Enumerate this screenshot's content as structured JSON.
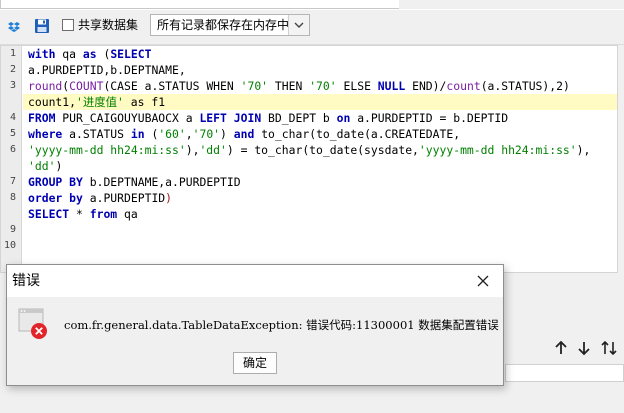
{
  "toolbar": {
    "share_label": "共享数据集",
    "memory_mode": "所有记录都保存在内存中"
  },
  "editor": {
    "line_numbers": [
      "1",
      "2",
      "3",
      "4",
      "5",
      "6",
      "7",
      "8",
      "9",
      "10"
    ],
    "lines": [
      [
        {
          "t": "with",
          "c": "kw"
        },
        {
          "t": " qa ",
          "c": ""
        },
        {
          "t": "as",
          "c": "kw"
        },
        {
          "t": " (",
          "c": ""
        },
        {
          "t": "SELECT",
          "c": "kw"
        }
      ],
      [
        {
          "t": "a.PURDEPTID,b.DEPTNAME,",
          "c": ""
        }
      ],
      [
        {
          "t": "round",
          "c": "fn"
        },
        {
          "t": "(",
          "c": ""
        },
        {
          "t": "COUNT",
          "c": "fn"
        },
        {
          "t": "(CASE a.STATUS WHEN ",
          "c": ""
        },
        {
          "t": "'70'",
          "c": "str"
        },
        {
          "t": " THEN ",
          "c": ""
        },
        {
          "t": "'70'",
          "c": "str"
        },
        {
          "t": " ELSE ",
          "c": ""
        },
        {
          "t": "NULL",
          "c": "kw"
        },
        {
          "t": " END)/",
          "c": ""
        },
        {
          "t": "count",
          "c": "fn"
        },
        {
          "t": "(a.STATUS),2)",
          "c": ""
        }
      ],
      [
        {
          "t": "count1,",
          "c": ""
        },
        {
          "t": "'进度值'",
          "c": "str"
        },
        {
          "t": " as f1",
          "c": ""
        }
      ],
      [
        {
          "t": "FROM",
          "c": "kw"
        },
        {
          "t": " PUR_CAIGOUYUBAOCX a ",
          "c": ""
        },
        {
          "t": "LEFT JOIN",
          "c": "kw"
        },
        {
          "t": " BD_DEPT b ",
          "c": ""
        },
        {
          "t": "on",
          "c": "kw"
        },
        {
          "t": " a.PURDEPTID = b.DEPTID",
          "c": ""
        }
      ],
      [
        {
          "t": "where",
          "c": "kw"
        },
        {
          "t": " a.STATUS ",
          "c": ""
        },
        {
          "t": "in",
          "c": "kw"
        },
        {
          "t": " (",
          "c": ""
        },
        {
          "t": "'60'",
          "c": "str"
        },
        {
          "t": ",",
          "c": ""
        },
        {
          "t": "'70'",
          "c": "str"
        },
        {
          "t": ") ",
          "c": ""
        },
        {
          "t": "and",
          "c": "kw"
        },
        {
          "t": " to_char(to_date(a.CREATEDATE,",
          "c": ""
        }
      ],
      [
        {
          "t": "'yyyy-mm-dd hh24:mi:ss'",
          "c": "str"
        },
        {
          "t": "),",
          "c": ""
        },
        {
          "t": "'dd'",
          "c": "str"
        },
        {
          "t": ") = to_char(to_date(sysdate,",
          "c": ""
        },
        {
          "t": "'yyyy-mm-dd hh24:mi:ss'",
          "c": "str"
        },
        {
          "t": "),",
          "c": ""
        }
      ],
      [
        {
          "t": "'dd'",
          "c": "str"
        },
        {
          "t": ")",
          "c": ""
        }
      ],
      [
        {
          "t": "GROUP BY",
          "c": "kw"
        },
        {
          "t": " b.DEPTNAME,a.PURDEPTID",
          "c": ""
        }
      ],
      [
        {
          "t": "order by",
          "c": "kw"
        },
        {
          "t": " a.PURDEPTID",
          "c": ""
        },
        {
          "t": ")",
          "c": "punc"
        }
      ],
      [
        {
          "t": "SELECT",
          "c": "kw"
        },
        {
          "t": " * ",
          "c": ""
        },
        {
          "t": "from",
          "c": "kw"
        },
        {
          "t": " qa",
          "c": ""
        }
      ]
    ],
    "line_map": [
      1,
      2,
      3,
      3,
      4,
      5,
      5,
      5,
      6,
      7,
      8,
      9,
      10
    ],
    "visual_rows": [
      0,
      1,
      2,
      3,
      4,
      5,
      6,
      7,
      8,
      9,
      10
    ]
  },
  "dialog": {
    "title": "错误",
    "message": "com.fr.general.data.TableDataException: 错误代码:11300001 数据集配置错误",
    "ok_label": "确定"
  },
  "colors": {
    "keyword": "#0000b3",
    "string": "#008000",
    "function": "#7a1fa2",
    "highlight": "#fffbc2",
    "error_badge": "#e0242a"
  }
}
